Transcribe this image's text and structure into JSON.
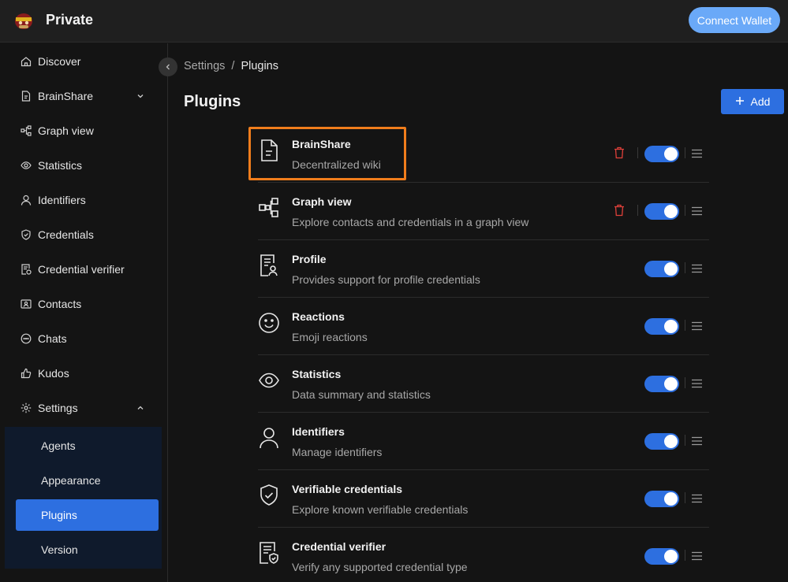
{
  "app": {
    "title": "Private",
    "logo_icon": "logo-icon",
    "connect_label": "Connect Wallet"
  },
  "sidebar": {
    "items": [
      {
        "label": "Discover",
        "icon": "home-icon"
      },
      {
        "label": "BrainShare",
        "icon": "document-icon",
        "chevron": "chevron-down-icon"
      },
      {
        "label": "Graph view",
        "icon": "graph-icon"
      },
      {
        "label": "Statistics",
        "icon": "eye-icon"
      },
      {
        "label": "Identifiers",
        "icon": "user-icon"
      },
      {
        "label": "Credentials",
        "icon": "shield-check-icon"
      },
      {
        "label": "Credential verifier",
        "icon": "file-check-icon"
      },
      {
        "label": "Contacts",
        "icon": "contacts-icon"
      },
      {
        "label": "Chats",
        "icon": "chat-icon"
      },
      {
        "label": "Kudos",
        "icon": "thumbs-up-icon"
      },
      {
        "label": "Settings",
        "icon": "gear-icon",
        "chevron": "chevron-up-icon"
      }
    ],
    "settings_sub": [
      {
        "label": "Agents",
        "active": false
      },
      {
        "label": "Appearance",
        "active": false
      },
      {
        "label": "Plugins",
        "active": true
      },
      {
        "label": "Version",
        "active": false
      }
    ]
  },
  "breadcrumb": {
    "root": "Settings",
    "sep": "/",
    "current": "Plugins"
  },
  "page": {
    "title": "Plugins",
    "add_label": "Add"
  },
  "plugins": [
    {
      "name": "BrainShare",
      "desc": "Decentralized wiki",
      "icon": "document-icon",
      "deletable": true,
      "enabled": true
    },
    {
      "name": "Graph view",
      "desc": "Explore contacts and credentials in a graph view",
      "icon": "graph-icon",
      "deletable": true,
      "enabled": true
    },
    {
      "name": "Profile",
      "desc": "Provides support for profile credentials",
      "icon": "profile-icon",
      "deletable": false,
      "enabled": true
    },
    {
      "name": "Reactions",
      "desc": "Emoji reactions",
      "icon": "smile-icon",
      "deletable": false,
      "enabled": true
    },
    {
      "name": "Statistics",
      "desc": "Data summary and statistics",
      "icon": "eye-icon",
      "deletable": false,
      "enabled": true
    },
    {
      "name": "Identifiers",
      "desc": "Manage identifiers",
      "icon": "user-icon",
      "deletable": false,
      "enabled": true
    },
    {
      "name": "Verifiable credentials",
      "desc": "Explore known verifiable credentials",
      "icon": "shield-check-icon",
      "deletable": false,
      "enabled": true
    },
    {
      "name": "Credential verifier",
      "desc": "Verify any supported credential type",
      "icon": "file-check-icon",
      "deletable": false,
      "enabled": true
    }
  ],
  "colors": {
    "accent": "#2d6fe0",
    "connect": "#6aa9f8",
    "highlight": "#f07d1c",
    "danger": "#e0403a"
  }
}
